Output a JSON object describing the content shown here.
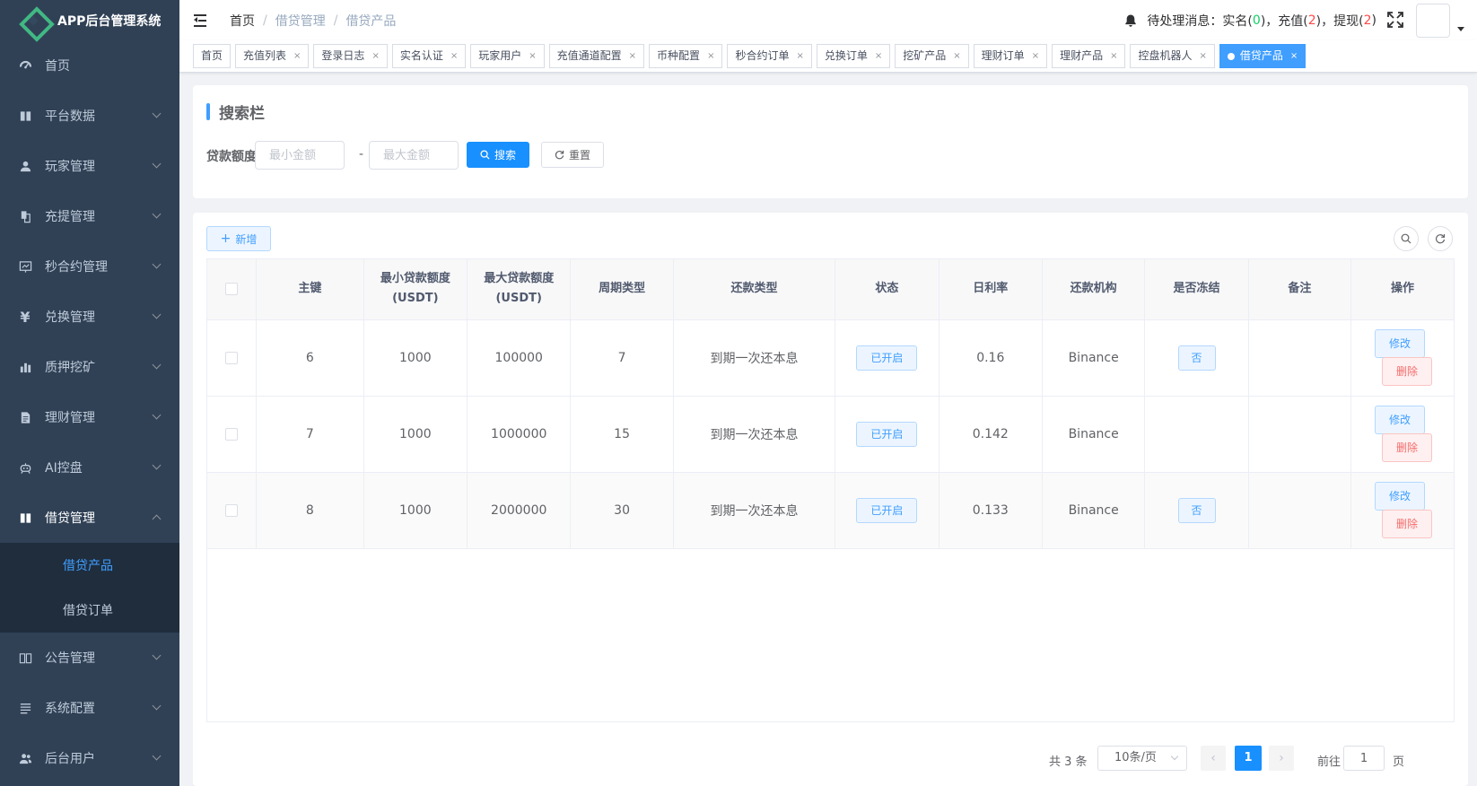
{
  "app": {
    "title": "APP后台管理系统"
  },
  "sidebar": {
    "items": [
      {
        "label": "首页",
        "icon": "dashboard-icon"
      },
      {
        "label": "平台数据",
        "icon": "book-icon"
      },
      {
        "label": "玩家管理",
        "icon": "user-icon"
      },
      {
        "label": "充提管理",
        "icon": "documents-icon"
      },
      {
        "label": "秒合约管理",
        "icon": "chart-board-icon"
      },
      {
        "label": "兑换管理",
        "icon": "yen-icon"
      },
      {
        "label": "质押挖矿",
        "icon": "bar-chart-icon"
      },
      {
        "label": "理财管理",
        "icon": "document-icon"
      },
      {
        "label": "AI控盘",
        "icon": "robot-icon"
      },
      {
        "label": "借贷管理",
        "icon": "book-icon",
        "open": true
      },
      {
        "label": "公告管理",
        "icon": "open-book-icon"
      },
      {
        "label": "系统配置",
        "icon": "list-icon"
      },
      {
        "label": "后台用户",
        "icon": "users-icon"
      }
    ],
    "sub_items": [
      {
        "label": "借贷产品",
        "active": true
      },
      {
        "label": "借贷订单",
        "active": false
      }
    ]
  },
  "header": {
    "breadcrumb": [
      "首页",
      "借贷管理",
      "借贷产品"
    ],
    "notice": {
      "prefix": "待处理消息：实名(",
      "realname_count": "0",
      "mid1": ")，充值(",
      "recharge_count": "2",
      "mid2": ")，提现(",
      "withdraw_count": "2",
      "suffix": ")"
    }
  },
  "tags": [
    {
      "label": "首页",
      "closable": false
    },
    {
      "label": "充值列表",
      "closable": true
    },
    {
      "label": "登录日志",
      "closable": true
    },
    {
      "label": "实名认证",
      "closable": true
    },
    {
      "label": "玩家用户",
      "closable": true
    },
    {
      "label": "充值通道配置",
      "closable": true
    },
    {
      "label": "币种配置",
      "closable": true
    },
    {
      "label": "秒合约订单",
      "closable": true
    },
    {
      "label": "兑换订单",
      "closable": true
    },
    {
      "label": "挖矿产品",
      "closable": true
    },
    {
      "label": "理财订单",
      "closable": true
    },
    {
      "label": "理财产品",
      "closable": true
    },
    {
      "label": "控盘机器人",
      "closable": true
    },
    {
      "label": "借贷产品",
      "closable": true,
      "active": true
    }
  ],
  "search": {
    "title": "搜索栏",
    "amount_label": "贷款额度",
    "min_placeholder": "最小金额",
    "max_placeholder": "最大金额",
    "dash": "-",
    "search_button": "搜索",
    "reset_button": "重置"
  },
  "toolbar": {
    "add_button": "新增"
  },
  "table": {
    "headers": [
      "主键",
      "最小贷款额度(USDT)",
      "最大贷款额度(USDT)",
      "周期类型",
      "还款类型",
      "状态",
      "日利率",
      "还款机构",
      "是否冻结",
      "备注",
      "操作"
    ],
    "rows": [
      {
        "id": "6",
        "min": "1000",
        "max": "100000",
        "period": "7",
        "repay_type": "到期一次还本息",
        "status": "已开启",
        "rate": "0.16",
        "org": "Binance",
        "frozen": "否",
        "remark": ""
      },
      {
        "id": "7",
        "min": "1000",
        "max": "1000000",
        "period": "15",
        "repay_type": "到期一次还本息",
        "status": "已开启",
        "rate": "0.142",
        "org": "Binance",
        "frozen": "",
        "remark": ""
      },
      {
        "id": "8",
        "min": "1000",
        "max": "2000000",
        "period": "30",
        "repay_type": "到期一次还本息",
        "status": "已开启",
        "rate": "0.133",
        "org": "Binance",
        "frozen": "否",
        "remark": ""
      }
    ],
    "edit_label": "修改",
    "delete_label": "删除"
  },
  "pagination": {
    "total_text": "共 3 条",
    "page_size": "10条/页",
    "current_page": "1",
    "goto_label": "前往",
    "goto_value": "1",
    "page_unit": "页"
  },
  "colors": {
    "sidebar_bg": "#304156",
    "primary": "#1890ff",
    "active_text": "#409eff"
  }
}
